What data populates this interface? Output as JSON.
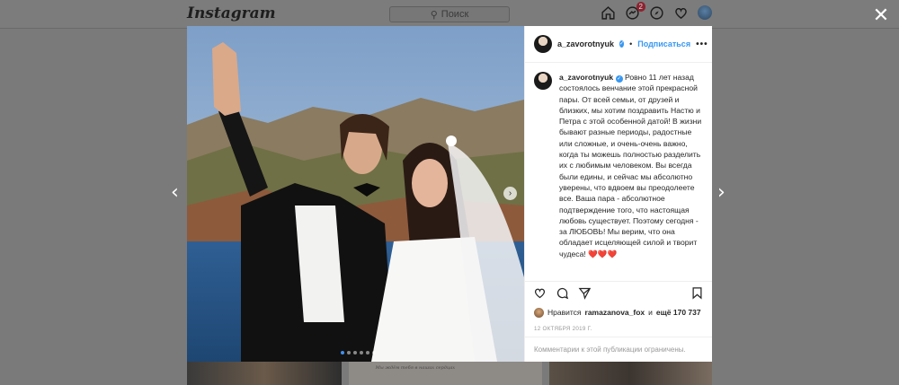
{
  "header": {
    "logo": "Instagram",
    "search_placeholder": "Поиск",
    "activity_badge": "2"
  },
  "post": {
    "author": "a_zavorotnyuk",
    "follow_label": "Подписаться",
    "separator": "•",
    "more_label": "•••",
    "caption": "Ровно 11 лет назад состоялось венчание этой прекрасной пары. От всей семьи, от друзей и близких, мы хотим поздравить Настю и Петра с этой особенной датой! В жизни бывают разные периоды, радостные или сложные, и очень-очень важно, когда ты можешь полностью разделить их с любимым человеком. Вы всегда были едины, и сейчас мы абсолютно уверены, что вдвоем вы преодолеете все. Ваша пара - абсолютное подтверждение того, что настоящая любовь существует. Поэтому сегодня - за ЛЮБОВЬ! Мы верим, что она обладает исцеляющей силой и творит чудеса! ❤️❤️❤️",
    "likes_prefix": "Нравится",
    "liker": "ramazanova_fox",
    "likes_and": "и",
    "likes_count": "ещё 170 737",
    "date": "12 ОКТЯБРЯ 2019 Г.",
    "comments_disabled": "Комментарии к этой публикации ограничены.",
    "carousel_count": 6,
    "carousel_active": 0
  },
  "icons": {
    "close": "close-icon",
    "prev": "chevron-left-icon",
    "next": "chevron-right-icon"
  },
  "colors": {
    "accent": "#3897f0",
    "verified": "#3897f0",
    "badge": "#ed4956"
  },
  "strip_text": "Мы ждём тебя в наших сердцах"
}
